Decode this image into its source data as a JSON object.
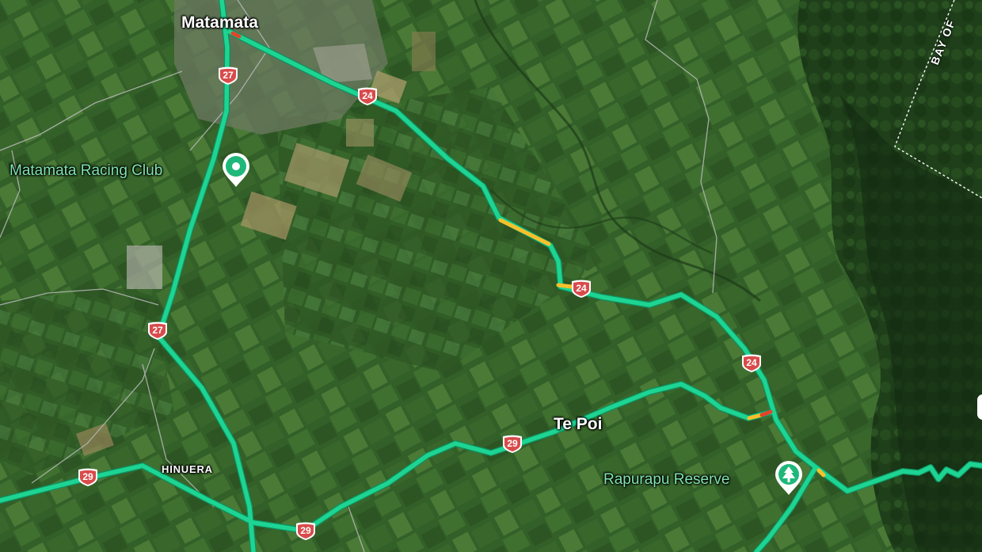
{
  "map": {
    "view": "satellite",
    "colors": {
      "road": "#1ed492",
      "road_edge": "#0e8f60",
      "traffic_slow": "#f7c02a",
      "traffic_heavy": "#e0452a",
      "shield": "#d94b4b",
      "poi": "#1fb87a",
      "boundary": "#b9b9b9"
    },
    "places": [
      {
        "name": "Matamata",
        "kind": "town"
      },
      {
        "name": "Te Poi",
        "kind": "locality"
      },
      {
        "name": "HINUERA",
        "kind": "locality"
      }
    ],
    "region_labels": [
      {
        "text": "BAY OF"
      }
    ],
    "pois": [
      {
        "name": "Matamata Racing Club",
        "icon": "location-pin-icon"
      },
      {
        "name": "Rapurapu Reserve",
        "icon": "tree-icon"
      }
    ],
    "highway_shields": [
      {
        "number": "27"
      },
      {
        "number": "24"
      },
      {
        "number": "27"
      },
      {
        "number": "24"
      },
      {
        "number": "24"
      },
      {
        "number": "29"
      },
      {
        "number": "29"
      },
      {
        "number": "29"
      }
    ]
  }
}
